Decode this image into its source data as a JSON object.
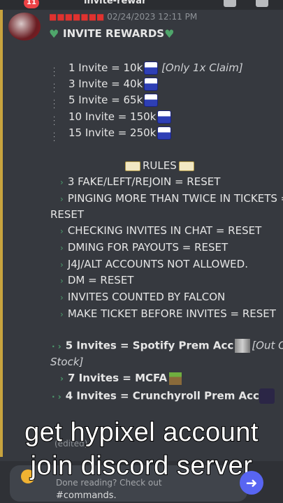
{
  "topbar": {
    "badge": "11",
    "channel": "invite-rewar"
  },
  "message": {
    "username": "■■■■■■■",
    "timestamp": "02/24/2023 12:11 PM",
    "title": "INVITE REWARDS",
    "rewards": [
      {
        "text": "1 Invite  = 10k",
        "note": "[Only 1x Claim]"
      },
      {
        "text": "3 Invite = 40k",
        "note": ""
      },
      {
        "text": "5 Invite = 65k",
        "note": ""
      },
      {
        "text": "10 Invite  = 150k",
        "note": ""
      },
      {
        "text": "15 Invite  = 250k",
        "note": ""
      }
    ],
    "rules_title": "RULES",
    "rules": [
      "3 FAKE/LEFT/REJOIN =  RESET",
      "PINGING MORE THAN TWICE IN TICKETS =",
      "RESET",
      "CHECKING INVITES IN CHAT = RESET",
      "DMING FOR PAYOUTS = RESET",
      "J4J/ALT ACCOUNTS NOT ALLOWED.",
      "DM = RESET",
      "INVITES COUNTED BY FALCON",
      "MAKE TICKET BEFORE INVITES = RESET"
    ],
    "prizes": [
      {
        "text": "5 Invites = Spotify Prem Acc",
        "note": "[Out Of"
      },
      {
        "text": "",
        "note": "Stock]"
      },
      {
        "text": "7 Invites = MCFA",
        "note": ""
      },
      {
        "text": "4 Invites = Crunchyroll Prem Acc",
        "note": ""
      }
    ]
  },
  "caption": {
    "line1": "get hypixel account",
    "line2": "join discord server"
  },
  "ghost_text": "(edited)",
  "input": {
    "line1": "Done reading? Check out",
    "line2": "#commands."
  },
  "icons": [
    "avatar",
    "heart-icon",
    "book-icon",
    "controller-icon",
    "send-icon",
    "add-icon"
  ],
  "colors": {
    "background": "#36393f",
    "accent": "#c8a33e",
    "send": "#5865f2"
  }
}
